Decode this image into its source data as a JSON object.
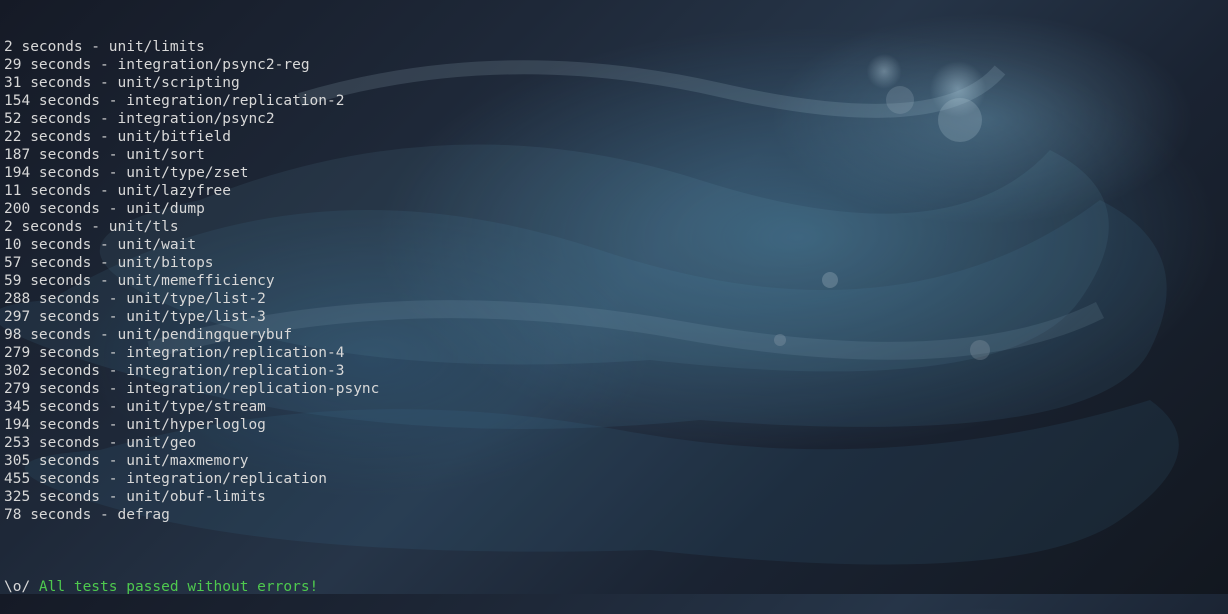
{
  "terminal": {
    "lines": [
      {
        "duration": "2",
        "name": "unit/limits"
      },
      {
        "duration": "29",
        "name": "integration/psync2-reg"
      },
      {
        "duration": "31",
        "name": "unit/scripting"
      },
      {
        "duration": "154",
        "name": "integration/replication-2"
      },
      {
        "duration": "52",
        "name": "integration/psync2"
      },
      {
        "duration": "22",
        "name": "unit/bitfield"
      },
      {
        "duration": "187",
        "name": "unit/sort"
      },
      {
        "duration": "194",
        "name": "unit/type/zset"
      },
      {
        "duration": "11",
        "name": "unit/lazyfree"
      },
      {
        "duration": "200",
        "name": "unit/dump"
      },
      {
        "duration": "2",
        "name": "unit/tls"
      },
      {
        "duration": "10",
        "name": "unit/wait"
      },
      {
        "duration": "57",
        "name": "unit/bitops"
      },
      {
        "duration": "59",
        "name": "unit/memefficiency"
      },
      {
        "duration": "288",
        "name": "unit/type/list-2"
      },
      {
        "duration": "297",
        "name": "unit/type/list-3"
      },
      {
        "duration": "98",
        "name": "unit/pendingquerybuf"
      },
      {
        "duration": "279",
        "name": "integration/replication-4"
      },
      {
        "duration": "302",
        "name": "integration/replication-3"
      },
      {
        "duration": "279",
        "name": "integration/replication-psync"
      },
      {
        "duration": "345",
        "name": "unit/type/stream"
      },
      {
        "duration": "194",
        "name": "unit/hyperloglog"
      },
      {
        "duration": "253",
        "name": "unit/geo"
      },
      {
        "duration": "305",
        "name": "unit/maxmemory"
      },
      {
        "duration": "455",
        "name": "integration/replication"
      },
      {
        "duration": "325",
        "name": "unit/obuf-limits"
      },
      {
        "duration": "78",
        "name": "defrag"
      }
    ],
    "summary": {
      "prefix": "\\o/ ",
      "message": "All tests passed without errors!"
    }
  }
}
